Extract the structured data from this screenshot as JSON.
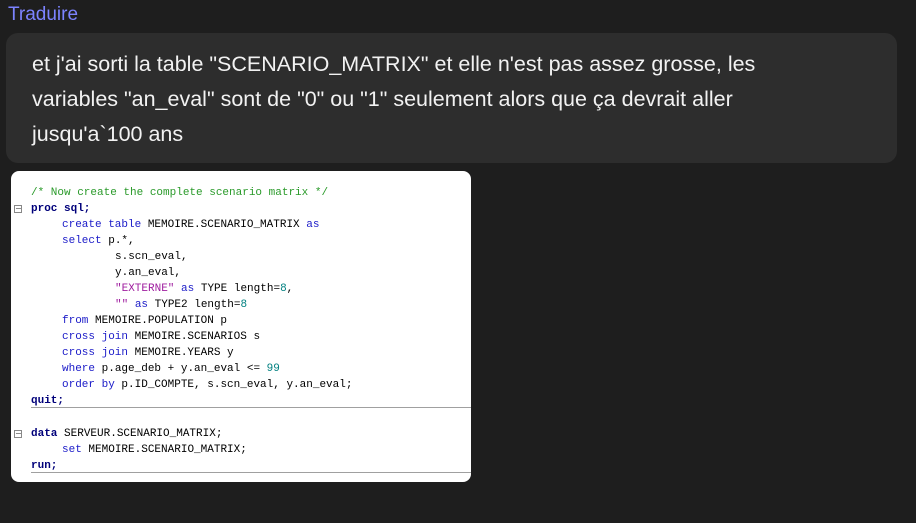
{
  "translate": {
    "label": "Traduire"
  },
  "message": {
    "lines": [
      "et j'ai sorti la table \"SCENARIO_MATRIX\" et elle n'est pas assez grosse, les",
      "variables \"an_eval\" sont de \"0\" ou \"1\" seulement alors que ça devrait aller",
      "jusqu'a`100 ans"
    ]
  },
  "code": {
    "comment": "/* Now create the complete scenario matrix */",
    "proc_sql": "proc sql;",
    "create_kw": "create table",
    "create_target": "MEMOIRE.SCENARIO_MATRIX",
    "as_kw": "as",
    "select_kw": "select",
    "select_first": "p.*,",
    "col_scn": "s.scn_eval,",
    "col_an": "y.an_eval,",
    "str_externe": "\"EXTERNE\"",
    "type_rest": "TYPE length=",
    "len1": "8",
    "comma": ",",
    "str_empty": "\"\"",
    "type2_rest": "TYPE2 length=",
    "len2": "8",
    "from_kw": "from",
    "from_target": "MEMOIRE.POPULATION p",
    "cross_join_kw": "cross join",
    "join1": "MEMOIRE.SCENARIOS s",
    "join2": "MEMOIRE.YEARS y",
    "where_kw": "where",
    "where_expr": "p.age_deb + y.an_eval <=",
    "where_num": "99",
    "order_kw": "order by",
    "order_expr": "p.ID_COMPTE, s.scn_eval, y.an_eval;",
    "quit": "quit;",
    "data_kw": "data",
    "data_target": "SERVEUR.SCENARIO_MATRIX;",
    "set_kw": "set",
    "set_target": "MEMOIRE.SCENARIO_MATRIX;",
    "run": "run;"
  }
}
